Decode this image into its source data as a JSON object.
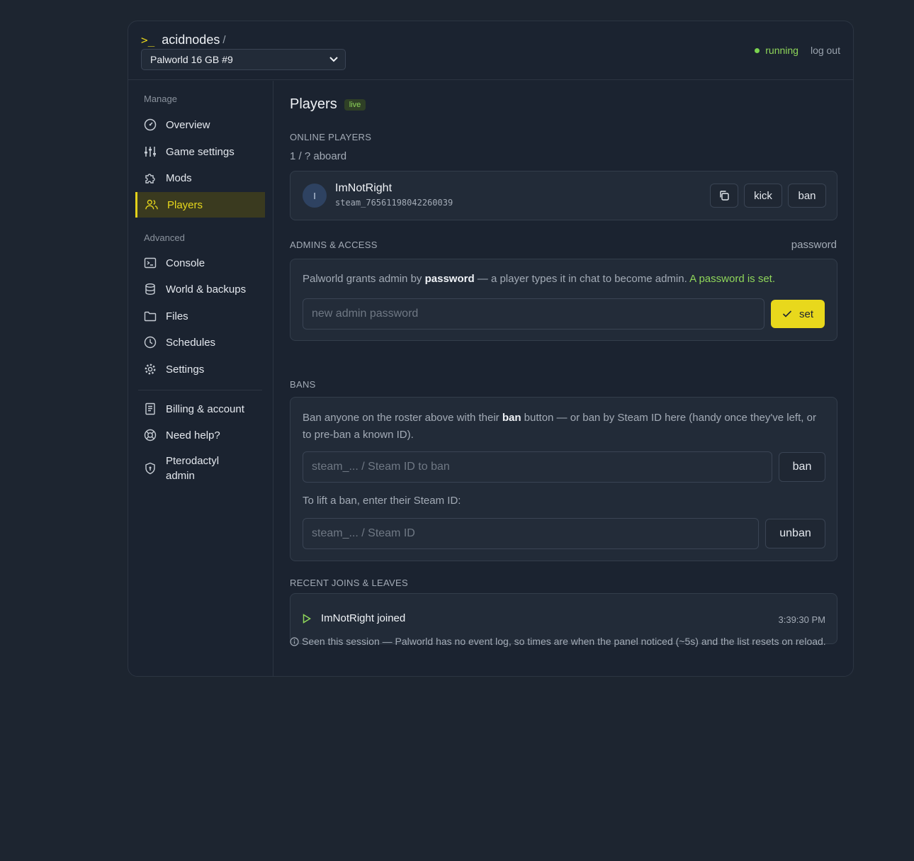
{
  "header": {
    "prompt": ">_",
    "brand": "acidnodes",
    "slash": "/",
    "server": "Palworld 16 GB #9",
    "status": "running",
    "logout": "log out"
  },
  "sidebar": {
    "manage_label": "Manage",
    "advanced_label": "Advanced",
    "manage_items": [
      "Overview",
      "Game settings",
      "Mods",
      "Players"
    ],
    "advanced_items": [
      "Console",
      "World & backups",
      "Files",
      "Schedules",
      "Settings"
    ],
    "account_items": [
      "Billing & account",
      "Need help?",
      "Pterodactyl",
      "admin"
    ]
  },
  "main": {
    "title": "Players",
    "live_badge": "live",
    "online_label": "ONLINE PLAYERS",
    "aboard": "1 / ? aboard",
    "player": {
      "initial": "I",
      "name": "ImNotRight",
      "steam_id": "steam_76561198042260039",
      "kick": "kick",
      "ban": "ban"
    },
    "admins": {
      "label": "ADMINS & ACCESS",
      "link": "password",
      "text_1": "Palworld grants admin by ",
      "text_bold": "password",
      "text_2": " — a player types it in chat to become admin. ",
      "text_green": "A password is set.",
      "placeholder": "new admin password",
      "set_button": "set"
    },
    "bans": {
      "label": "BANS",
      "text_1": "Ban anyone on the roster above with their ",
      "text_bold": "ban",
      "text_2": " button — or ban by Steam ID here (handy once they've left, or to pre-ban a known ID).",
      "ban_placeholder": "steam_... / Steam ID to ban",
      "ban_button": "ban",
      "lift_text": "To lift a ban, enter their Steam ID:",
      "unban_placeholder": "steam_... / Steam ID",
      "unban_button": "unban"
    },
    "recent": {
      "label": "RECENT JOINS & LEAVES",
      "event": "ImNotRight joined",
      "time": "3:39:30 PM"
    },
    "footnote": "Seen this session — Palworld has no event log, so times are when the panel noticed (~5s) and the list resets on reload."
  },
  "colors": {
    "accent": "#e8d81c",
    "running": "#8fd65a",
    "background": "#1d2530"
  }
}
